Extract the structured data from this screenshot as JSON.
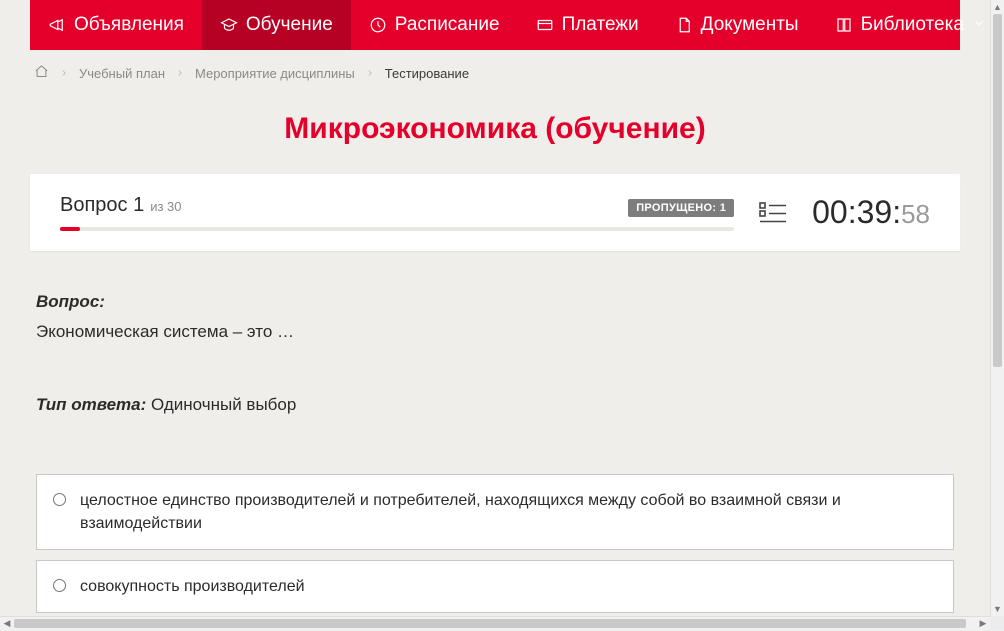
{
  "nav": {
    "items": [
      {
        "label": "Объявления",
        "icon": "megaphone-icon",
        "active": false
      },
      {
        "label": "Обучение",
        "icon": "graduation-icon",
        "active": true
      },
      {
        "label": "Расписание",
        "icon": "clock-icon",
        "active": false
      },
      {
        "label": "Платежи",
        "icon": "card-icon",
        "active": false
      },
      {
        "label": "Документы",
        "icon": "document-icon",
        "active": false
      },
      {
        "label": "Библиотека",
        "icon": "book-icon",
        "active": false,
        "has_chevron": true
      }
    ]
  },
  "breadcrumb": {
    "items": [
      {
        "label": "Учебный план"
      },
      {
        "label": "Мероприятие дисциплины"
      }
    ],
    "current": "Тестирование"
  },
  "page_title": "Микроэкономика (обучение)",
  "question_header": {
    "question_label": "Вопрос 1",
    "total_label": "из 30",
    "skipped_badge": "ПРОПУЩЕНО: 1",
    "timer_main": "00:39:",
    "timer_secs": "58"
  },
  "question": {
    "label": "Вопрос:",
    "text": "Экономическая система – это …",
    "answer_type_label": "Тип ответа:",
    "answer_type_value": "Одиночный выбор"
  },
  "answers": [
    {
      "text": "целостное единство производителей и потребителей, находящихся между собой во взаимной связи и взаимодействии"
    },
    {
      "text": "совокупность производителей"
    },
    {
      "text": ""
    }
  ]
}
